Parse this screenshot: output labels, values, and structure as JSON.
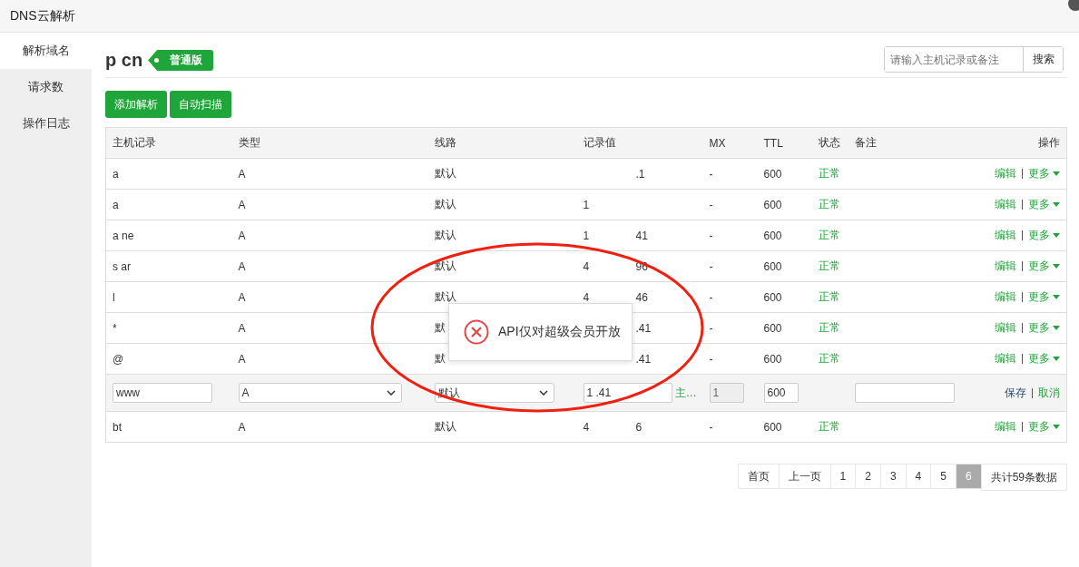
{
  "window": {
    "title": "DNS云解析"
  },
  "sidebar": {
    "items": [
      {
        "label": "解析域名",
        "selected": true
      },
      {
        "label": "请求数",
        "selected": false
      },
      {
        "label": "操作日志",
        "selected": false
      }
    ]
  },
  "domain": {
    "name": "p cn",
    "badge": "普通版"
  },
  "search": {
    "placeholder": "请输入主机记录或备注",
    "button": "搜索"
  },
  "actions": [
    "添加解析",
    "自动扫描"
  ],
  "table": {
    "columns": [
      "主机记录",
      "类型",
      "线路",
      "记录值",
      "MX",
      "TTL",
      "状态",
      "备注",
      "操作"
    ],
    "rows": [
      {
        "kind": "record",
        "host": "a",
        "type": "A",
        "line": "默认",
        "value_tail": ".1",
        "mx": "-",
        "ttl": "600",
        "status": "正常",
        "edit": "编辑",
        "more": "更多"
      },
      {
        "kind": "record",
        "host": "a",
        "type": "A",
        "line": "默认",
        "value_head": "1",
        "mx": "-",
        "ttl": "600",
        "status": "正常",
        "edit": "编辑",
        "more": "更多"
      },
      {
        "kind": "record",
        "host": "a ne",
        "type": "A",
        "line": "默认",
        "value_head": "1",
        "value_tail": "41",
        "mx": "-",
        "ttl": "600",
        "status": "正常",
        "edit": "编辑",
        "more": "更多"
      },
      {
        "kind": "record",
        "host": "s ar",
        "type": "A",
        "line": "默认",
        "value_head": "4",
        "value_tail": "96",
        "mx": "-",
        "ttl": "600",
        "status": "正常",
        "edit": "编辑",
        "more": "更多"
      },
      {
        "kind": "record",
        "host": "l",
        "type": "A",
        "line": "默认",
        "value_head": "4",
        "value_tail": "46",
        "mx": "-",
        "ttl": "600",
        "status": "正常",
        "edit": "编辑",
        "more": "更多"
      },
      {
        "kind": "record",
        "host": "*",
        "type": "A",
        "line": "默",
        "value_tail": ".41",
        "mx": "-",
        "ttl": "600",
        "status": "正常",
        "edit": "编辑",
        "more": "更多"
      },
      {
        "kind": "record",
        "host": "@",
        "type": "A",
        "line": "默",
        "value_tail": ".41",
        "mx": "-",
        "ttl": "600",
        "status": "正常",
        "edit": "编辑",
        "more": "更多"
      },
      {
        "kind": "edit",
        "host": "www",
        "type": "A",
        "line": "默认",
        "value": "1 .41",
        "line_link": "主…",
        "mx": "1",
        "ttl": "600",
        "save": "保存",
        "cancel": "取消"
      },
      {
        "kind": "record",
        "host": "bt",
        "type": "A",
        "line": "默认",
        "value_head": "4",
        "value_tail": "6",
        "mx": "-",
        "ttl": "600",
        "status": "正常",
        "edit": "编辑",
        "more": "更多"
      }
    ]
  },
  "pagination": {
    "pages": [
      {
        "label": "首页",
        "selected": false
      },
      {
        "label": "上一页",
        "selected": false
      },
      {
        "label": "1",
        "selected": false
      },
      {
        "label": "2",
        "selected": false
      },
      {
        "label": "3",
        "selected": false
      },
      {
        "label": "4",
        "selected": false
      },
      {
        "label": "5",
        "selected": false
      },
      {
        "label": "6",
        "selected": true
      }
    ],
    "total": "共计59条数据"
  },
  "toast": {
    "message": "API仅对超级会员开放"
  }
}
